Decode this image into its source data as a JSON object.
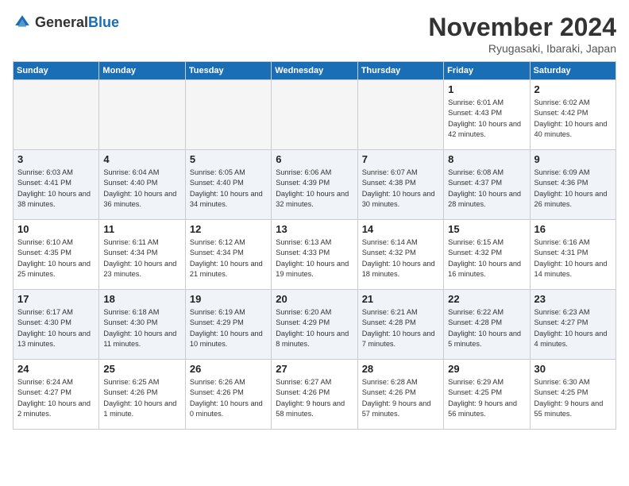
{
  "header": {
    "logo_general": "General",
    "logo_blue": "Blue",
    "month_title": "November 2024",
    "location": "Ryugasaki, Ibaraki, Japan"
  },
  "days_of_week": [
    "Sunday",
    "Monday",
    "Tuesday",
    "Wednesday",
    "Thursday",
    "Friday",
    "Saturday"
  ],
  "weeks": [
    [
      {
        "day": "",
        "empty": true
      },
      {
        "day": "",
        "empty": true
      },
      {
        "day": "",
        "empty": true
      },
      {
        "day": "",
        "empty": true
      },
      {
        "day": "",
        "empty": true
      },
      {
        "day": "1",
        "sunrise": "Sunrise: 6:01 AM",
        "sunset": "Sunset: 4:43 PM",
        "daylight": "Daylight: 10 hours and 42 minutes."
      },
      {
        "day": "2",
        "sunrise": "Sunrise: 6:02 AM",
        "sunset": "Sunset: 4:42 PM",
        "daylight": "Daylight: 10 hours and 40 minutes."
      }
    ],
    [
      {
        "day": "3",
        "sunrise": "Sunrise: 6:03 AM",
        "sunset": "Sunset: 4:41 PM",
        "daylight": "Daylight: 10 hours and 38 minutes."
      },
      {
        "day": "4",
        "sunrise": "Sunrise: 6:04 AM",
        "sunset": "Sunset: 4:40 PM",
        "daylight": "Daylight: 10 hours and 36 minutes."
      },
      {
        "day": "5",
        "sunrise": "Sunrise: 6:05 AM",
        "sunset": "Sunset: 4:40 PM",
        "daylight": "Daylight: 10 hours and 34 minutes."
      },
      {
        "day": "6",
        "sunrise": "Sunrise: 6:06 AM",
        "sunset": "Sunset: 4:39 PM",
        "daylight": "Daylight: 10 hours and 32 minutes."
      },
      {
        "day": "7",
        "sunrise": "Sunrise: 6:07 AM",
        "sunset": "Sunset: 4:38 PM",
        "daylight": "Daylight: 10 hours and 30 minutes."
      },
      {
        "day": "8",
        "sunrise": "Sunrise: 6:08 AM",
        "sunset": "Sunset: 4:37 PM",
        "daylight": "Daylight: 10 hours and 28 minutes."
      },
      {
        "day": "9",
        "sunrise": "Sunrise: 6:09 AM",
        "sunset": "Sunset: 4:36 PM",
        "daylight": "Daylight: 10 hours and 26 minutes."
      }
    ],
    [
      {
        "day": "10",
        "sunrise": "Sunrise: 6:10 AM",
        "sunset": "Sunset: 4:35 PM",
        "daylight": "Daylight: 10 hours and 25 minutes."
      },
      {
        "day": "11",
        "sunrise": "Sunrise: 6:11 AM",
        "sunset": "Sunset: 4:34 PM",
        "daylight": "Daylight: 10 hours and 23 minutes."
      },
      {
        "day": "12",
        "sunrise": "Sunrise: 6:12 AM",
        "sunset": "Sunset: 4:34 PM",
        "daylight": "Daylight: 10 hours and 21 minutes."
      },
      {
        "day": "13",
        "sunrise": "Sunrise: 6:13 AM",
        "sunset": "Sunset: 4:33 PM",
        "daylight": "Daylight: 10 hours and 19 minutes."
      },
      {
        "day": "14",
        "sunrise": "Sunrise: 6:14 AM",
        "sunset": "Sunset: 4:32 PM",
        "daylight": "Daylight: 10 hours and 18 minutes."
      },
      {
        "day": "15",
        "sunrise": "Sunrise: 6:15 AM",
        "sunset": "Sunset: 4:32 PM",
        "daylight": "Daylight: 10 hours and 16 minutes."
      },
      {
        "day": "16",
        "sunrise": "Sunrise: 6:16 AM",
        "sunset": "Sunset: 4:31 PM",
        "daylight": "Daylight: 10 hours and 14 minutes."
      }
    ],
    [
      {
        "day": "17",
        "sunrise": "Sunrise: 6:17 AM",
        "sunset": "Sunset: 4:30 PM",
        "daylight": "Daylight: 10 hours and 13 minutes."
      },
      {
        "day": "18",
        "sunrise": "Sunrise: 6:18 AM",
        "sunset": "Sunset: 4:30 PM",
        "daylight": "Daylight: 10 hours and 11 minutes."
      },
      {
        "day": "19",
        "sunrise": "Sunrise: 6:19 AM",
        "sunset": "Sunset: 4:29 PM",
        "daylight": "Daylight: 10 hours and 10 minutes."
      },
      {
        "day": "20",
        "sunrise": "Sunrise: 6:20 AM",
        "sunset": "Sunset: 4:29 PM",
        "daylight": "Daylight: 10 hours and 8 minutes."
      },
      {
        "day": "21",
        "sunrise": "Sunrise: 6:21 AM",
        "sunset": "Sunset: 4:28 PM",
        "daylight": "Daylight: 10 hours and 7 minutes."
      },
      {
        "day": "22",
        "sunrise": "Sunrise: 6:22 AM",
        "sunset": "Sunset: 4:28 PM",
        "daylight": "Daylight: 10 hours and 5 minutes."
      },
      {
        "day": "23",
        "sunrise": "Sunrise: 6:23 AM",
        "sunset": "Sunset: 4:27 PM",
        "daylight": "Daylight: 10 hours and 4 minutes."
      }
    ],
    [
      {
        "day": "24",
        "sunrise": "Sunrise: 6:24 AM",
        "sunset": "Sunset: 4:27 PM",
        "daylight": "Daylight: 10 hours and 2 minutes."
      },
      {
        "day": "25",
        "sunrise": "Sunrise: 6:25 AM",
        "sunset": "Sunset: 4:26 PM",
        "daylight": "Daylight: 10 hours and 1 minute."
      },
      {
        "day": "26",
        "sunrise": "Sunrise: 6:26 AM",
        "sunset": "Sunset: 4:26 PM",
        "daylight": "Daylight: 10 hours and 0 minutes."
      },
      {
        "day": "27",
        "sunrise": "Sunrise: 6:27 AM",
        "sunset": "Sunset: 4:26 PM",
        "daylight": "Daylight: 9 hours and 58 minutes."
      },
      {
        "day": "28",
        "sunrise": "Sunrise: 6:28 AM",
        "sunset": "Sunset: 4:26 PM",
        "daylight": "Daylight: 9 hours and 57 minutes."
      },
      {
        "day": "29",
        "sunrise": "Sunrise: 6:29 AM",
        "sunset": "Sunset: 4:25 PM",
        "daylight": "Daylight: 9 hours and 56 minutes."
      },
      {
        "day": "30",
        "sunrise": "Sunrise: 6:30 AM",
        "sunset": "Sunset: 4:25 PM",
        "daylight": "Daylight: 9 hours and 55 minutes."
      }
    ]
  ]
}
